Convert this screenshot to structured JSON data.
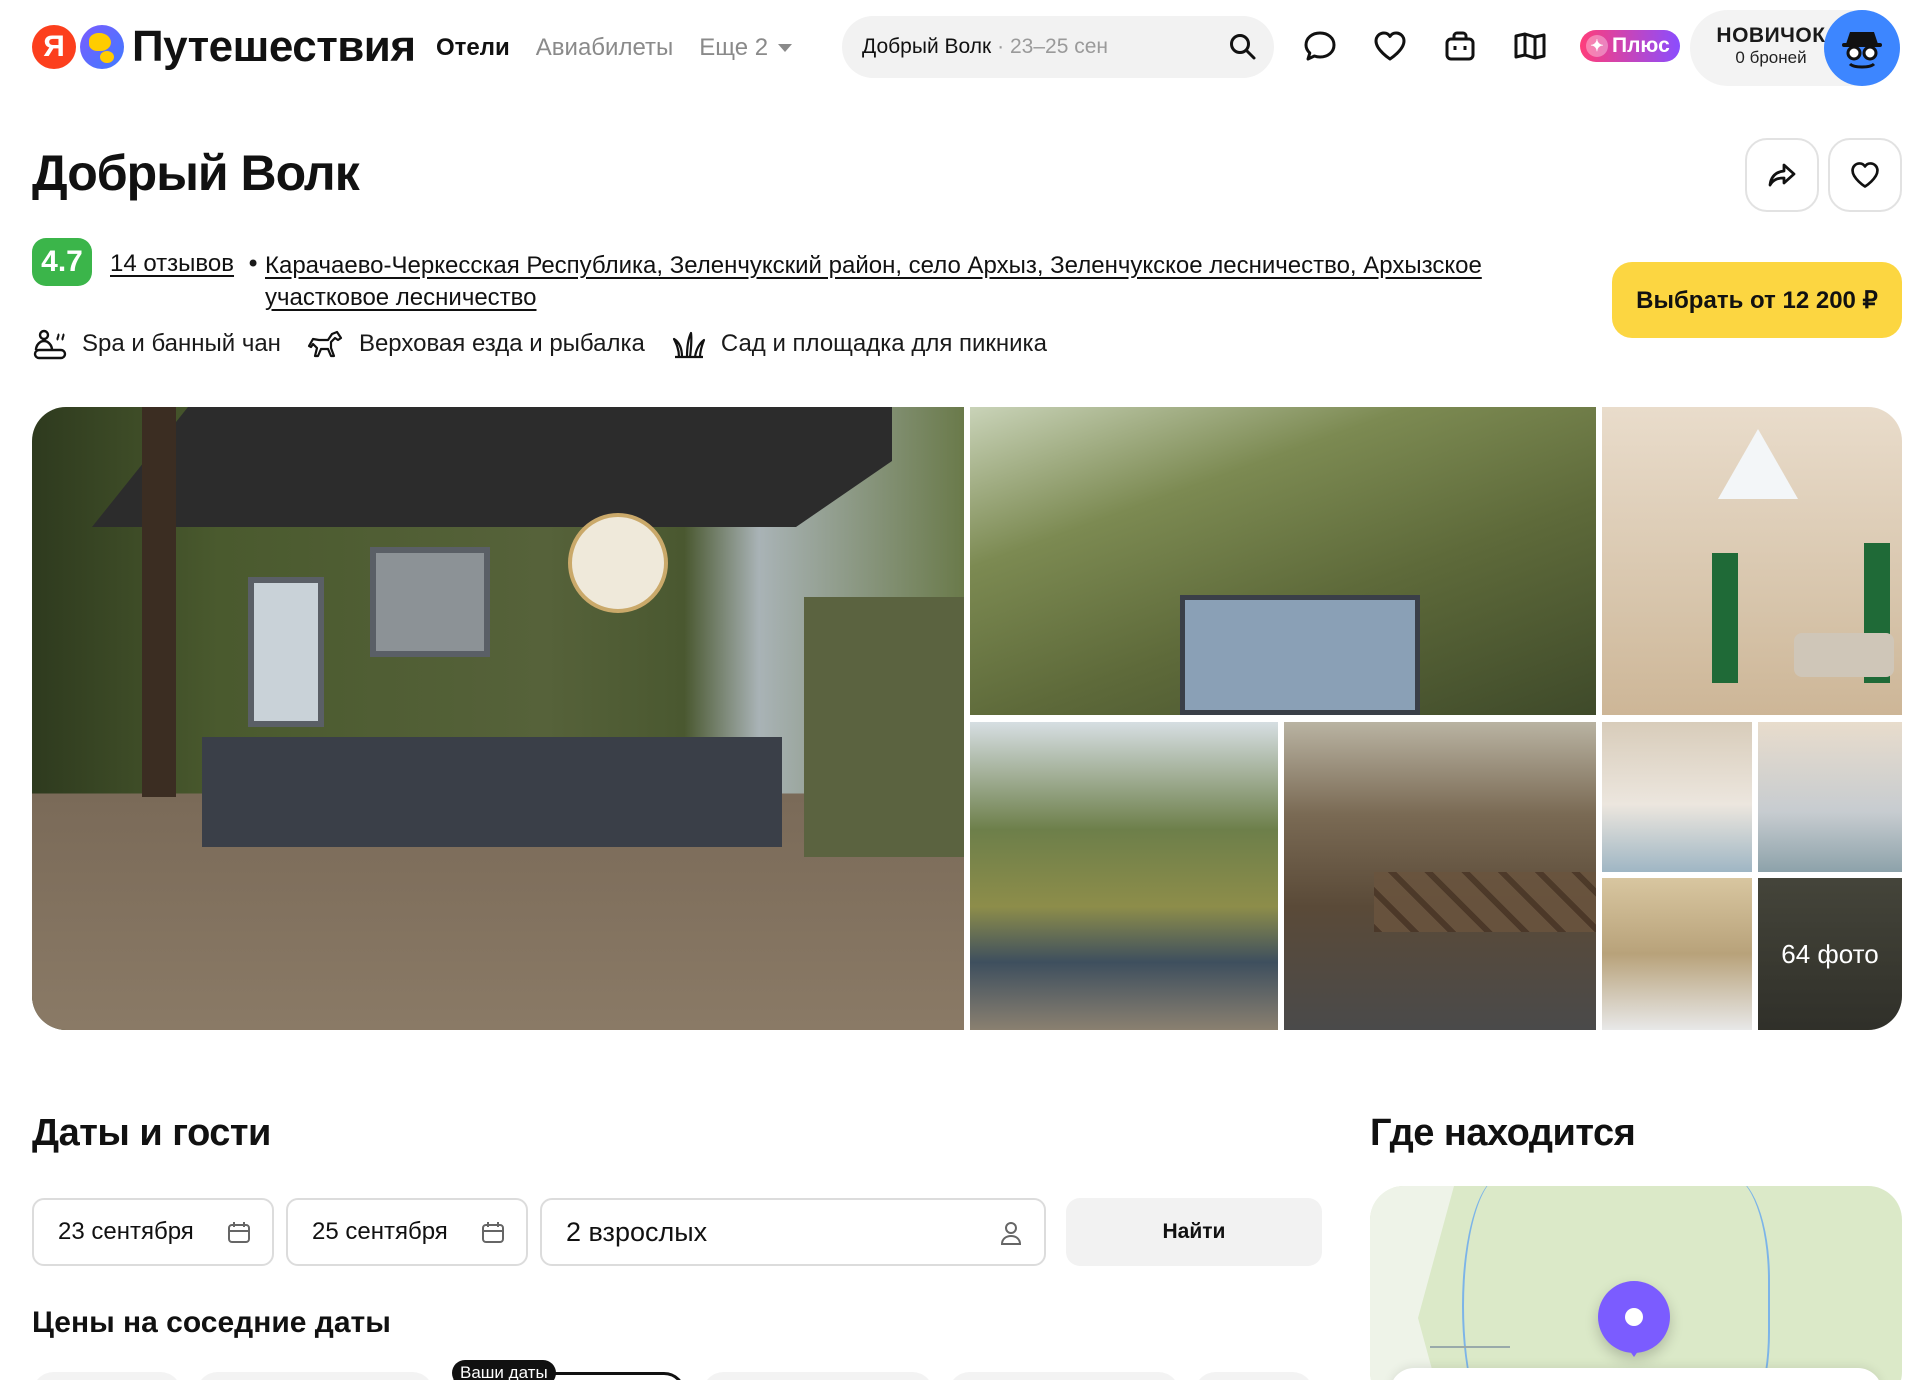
{
  "header": {
    "logo_letter": "Я",
    "logo_text": "Путешествия",
    "nav": {
      "hotels": "Отели",
      "flights": "Авиабилеты",
      "more": "Еще 2"
    },
    "search": {
      "query": "Добрый Волк",
      "dates": "· 23–25 сен"
    },
    "plus_label": "Плюс",
    "user": {
      "status": "НОВИЧОК",
      "bookings": "0 броней"
    }
  },
  "hotel": {
    "name": "Добрый Волк",
    "rating": "4.7",
    "reviews": "14 отзывов",
    "bullet": "•",
    "address": "Карачаево-Черкесская Республика, Зеленчукский район, село Архыз, Зеленчукское лесничество, Архызское участковое лесничество",
    "cta": "Выбрать от 12 200 ₽",
    "amenities": [
      "Spa и банный чан",
      "Верховая езда и рыбалка",
      "Сад и площадка для пикника"
    ],
    "photos_count": "64 фото"
  },
  "booking": {
    "title": "Даты и гости",
    "checkin": "23 сентября",
    "checkout": "25 сентября",
    "guests": "2 взрослых",
    "find": "Найти",
    "nearby_title": "Цены на соседние даты",
    "your_dates": "Ваши даты"
  },
  "location": {
    "title": "Где находится"
  },
  "colors": {
    "rating_green": "#3bb54a",
    "cta_yellow": "#fcd641",
    "pin_purple": "#7b5cff",
    "avatar_blue": "#3d86ff"
  }
}
